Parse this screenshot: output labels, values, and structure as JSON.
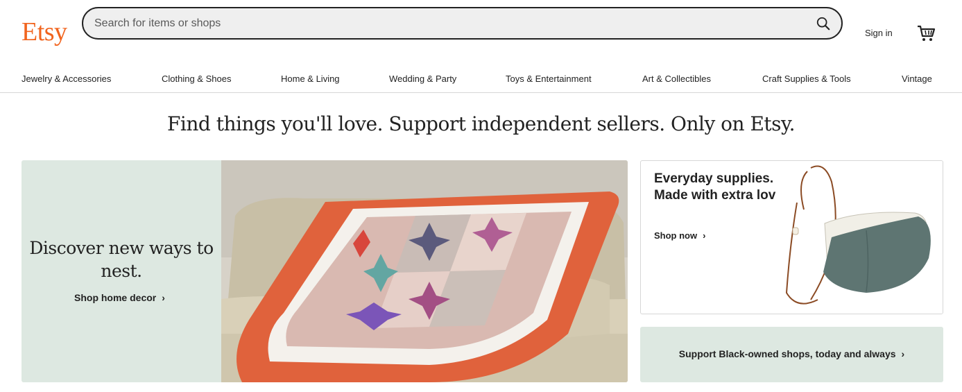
{
  "header": {
    "logo": "Etsy",
    "search_placeholder": "Search for items or shops",
    "sign_in": "Sign in",
    "brand_color": "#f1641e"
  },
  "nav": {
    "items": [
      {
        "label": "Jewelry & Accessories"
      },
      {
        "label": "Clothing & Shoes"
      },
      {
        "label": "Home & Living"
      },
      {
        "label": "Wedding & Party"
      },
      {
        "label": "Toys & Entertainment"
      },
      {
        "label": "Art & Collectibles"
      },
      {
        "label": "Craft Supplies & Tools"
      },
      {
        "label": "Vintage"
      }
    ]
  },
  "main": {
    "tagline": "Find things you'll love. Support independent sellers. Only on Etsy.",
    "hero": {
      "title": "Discover new ways to nest.",
      "link": "Shop home decor",
      "bg_color": "#dde8e1"
    },
    "promo1": {
      "title": "Everyday supplies. Made with extra love.",
      "link": "Shop now"
    },
    "promo2": {
      "text": "Support Black-owned shops, today and always",
      "bg_color": "#dde8e1"
    },
    "chevron": "›"
  },
  "icons": {
    "search": "search-icon",
    "cart": "cart-icon",
    "chevron": "chevron-right-icon"
  }
}
